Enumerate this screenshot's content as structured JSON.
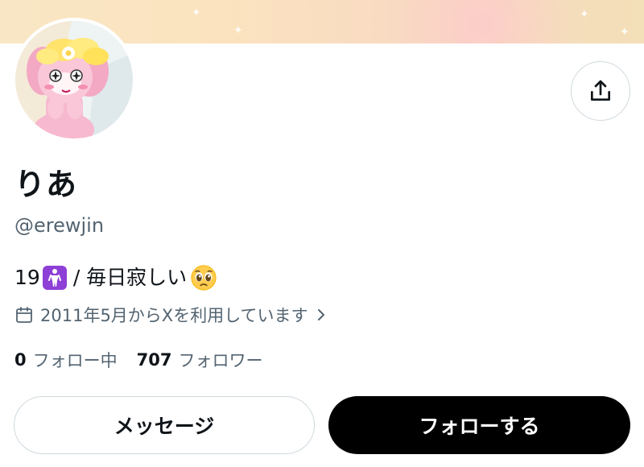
{
  "profile": {
    "display_name": "りあ",
    "handle": "@erewjin",
    "bio": {
      "age": "19",
      "emoji_1": "person-standing-emoji",
      "text": "/ 毎日寂しい",
      "emoji_2": "pleading-face-emoji"
    },
    "joined": "2011年5月からXを利用しています",
    "following": {
      "count": "0",
      "label": "フォロー中"
    },
    "followers": {
      "count": "707",
      "label": "フォロワー"
    }
  },
  "actions": {
    "message_label": "メッセージ",
    "follow_label": "フォローする"
  },
  "icons": {
    "share": "share-icon",
    "calendar": "calendar-icon",
    "chevron": "chevron-right-icon"
  },
  "colors": {
    "text_primary": "#0f1419",
    "text_secondary": "#536471",
    "border": "#cfd9de",
    "follow_bg": "#000000",
    "emoji_box": "#8e3fd6"
  }
}
